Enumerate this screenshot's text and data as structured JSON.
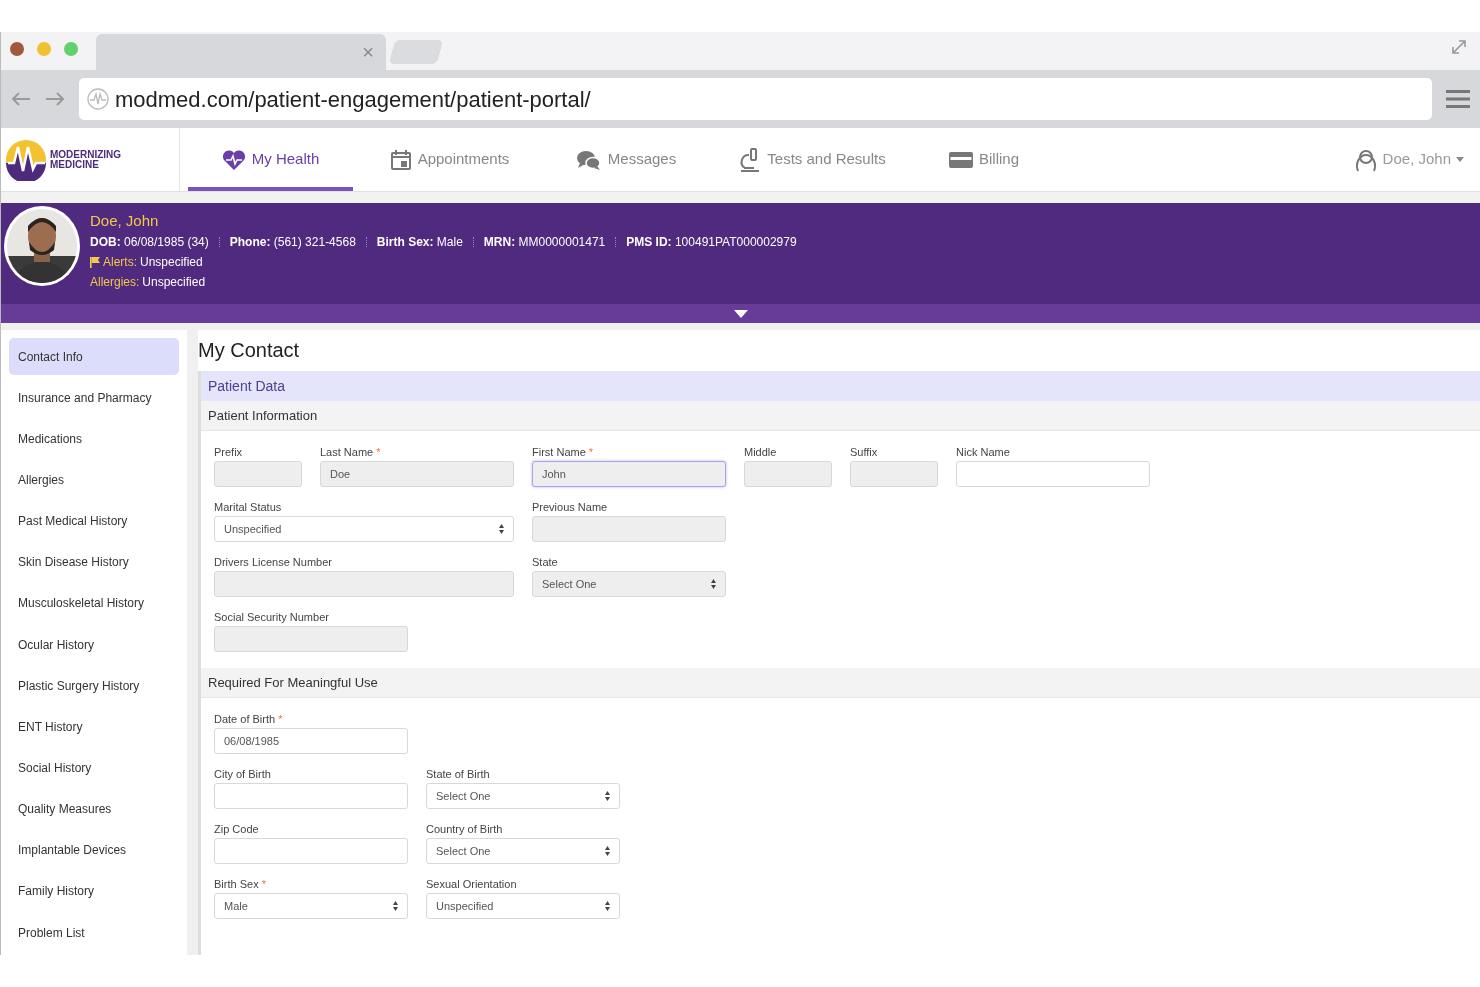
{
  "browser": {
    "tab_close": "×",
    "url": "modmed.com/patient-engagement/patient-portal/"
  },
  "logo": {
    "line1": "MODERNIZING",
    "line2": "MEDICINE"
  },
  "nav": [
    {
      "label": "My Health",
      "selected": true
    },
    {
      "label": "Appointments",
      "selected": false
    },
    {
      "label": "Messages",
      "selected": false
    },
    {
      "label": "Tests and Results",
      "selected": false
    },
    {
      "label": "Billing",
      "selected": false
    }
  ],
  "user_menu": {
    "label": "Doe, John"
  },
  "patient": {
    "name": "Doe, John",
    "details": [
      "**DOB:** 06/08/1985 (34)",
      "**Phone:** (561) 321-4568",
      "**Birth Sex:** Male",
      "**MRN:** MM0000001471",
      "**PMS ID:** 100491PAT000002979"
    ],
    "alerts": {
      "label": "Alerts:",
      "value": "Unspecified"
    },
    "allergies": {
      "label": "Allergies:",
      "value": "Unspecified"
    }
  },
  "sidebar": [
    {
      "label": "Contact Info",
      "selected": true
    },
    {
      "label": "Insurance and Pharmacy",
      "selected": false
    },
    {
      "label": "Medications",
      "selected": false
    },
    {
      "label": "Allergies",
      "selected": false
    },
    {
      "label": "Past Medical History",
      "selected": false
    },
    {
      "label": "Skin Disease History",
      "selected": false
    },
    {
      "label": "Musculoskeletal History",
      "selected": false
    },
    {
      "label": "Ocular History",
      "selected": false
    },
    {
      "label": "Plastic Surgery History",
      "selected": false
    },
    {
      "label": "ENT History",
      "selected": false
    },
    {
      "label": "Social History",
      "selected": false
    },
    {
      "label": "Quality Measures",
      "selected": false
    },
    {
      "label": "Implantable Devices",
      "selected": false
    },
    {
      "label": "Family History",
      "selected": false
    },
    {
      "label": "Problem List",
      "selected": false
    }
  ],
  "page_title": "My Contact",
  "required_mark": "*",
  "panel": {
    "title": "Patient Data",
    "sections": [
      {
        "title": "Patient Information",
        "rows": [
          [
            {
              "label": "Prefix",
              "required": false,
              "kind": "input",
              "disabled": true,
              "focused": false
            },
            {
              "label": "Last Name",
              "required": true,
              "kind": "input",
              "value": "Doe",
              "disabled": true,
              "focused": false
            },
            {
              "label": "First Name",
              "required": true,
              "kind": "input",
              "value": "John",
              "disabled": true,
              "focused": true
            },
            {
              "label": "Middle",
              "required": false,
              "kind": "input",
              "disabled": true,
              "focused": false
            },
            {
              "label": "Suffix",
              "required": false,
              "kind": "input",
              "disabled": true,
              "focused": false
            },
            {
              "label": "Nick Name",
              "required": false,
              "kind": "input",
              "disabled": false,
              "focused": false
            }
          ],
          [
            {
              "label": "Marital Status",
              "required": false,
              "kind": "select",
              "value": "Unspecified",
              "disabled": false,
              "focused": false
            },
            {
              "label": "Previous Name",
              "required": false,
              "kind": "input",
              "disabled": true,
              "focused": false
            }
          ],
          [
            {
              "label": "Drivers License Number",
              "required": false,
              "kind": "input",
              "disabled": true,
              "focused": false
            },
            {
              "label": "State",
              "required": false,
              "kind": "select",
              "value": "Select One",
              "disabled": true,
              "focused": false
            }
          ],
          [
            {
              "label": "Social Security Number",
              "required": false,
              "kind": "input",
              "disabled": true,
              "focused": false
            }
          ]
        ]
      },
      {
        "title": "Required For Meaningful Use",
        "rows": [
          [
            {
              "label": "Date of Birth",
              "required": true,
              "kind": "input",
              "value": "06/08/1985",
              "disabled": false,
              "focused": false
            }
          ],
          [
            {
              "label": "City of Birth",
              "required": false,
              "kind": "input",
              "disabled": false,
              "focused": false
            },
            {
              "label": "State of Birth",
              "required": false,
              "kind": "select",
              "value": "Select One",
              "disabled": false,
              "focused": false
            }
          ],
          [
            {
              "label": "Zip Code",
              "required": false,
              "kind": "input",
              "disabled": false,
              "focused": false
            },
            {
              "label": "Country of Birth",
              "required": false,
              "kind": "select",
              "value": "Select One",
              "disabled": false,
              "focused": false
            }
          ],
          [
            {
              "label": "Birth Sex",
              "required": true,
              "kind": "select",
              "value": "Male",
              "disabled": false,
              "focused": false
            },
            {
              "label": "Sexual Orientation",
              "required": false,
              "kind": "select",
              "value": "Unspecified",
              "disabled": false,
              "focused": false
            }
          ]
        ]
      }
    ]
  }
}
